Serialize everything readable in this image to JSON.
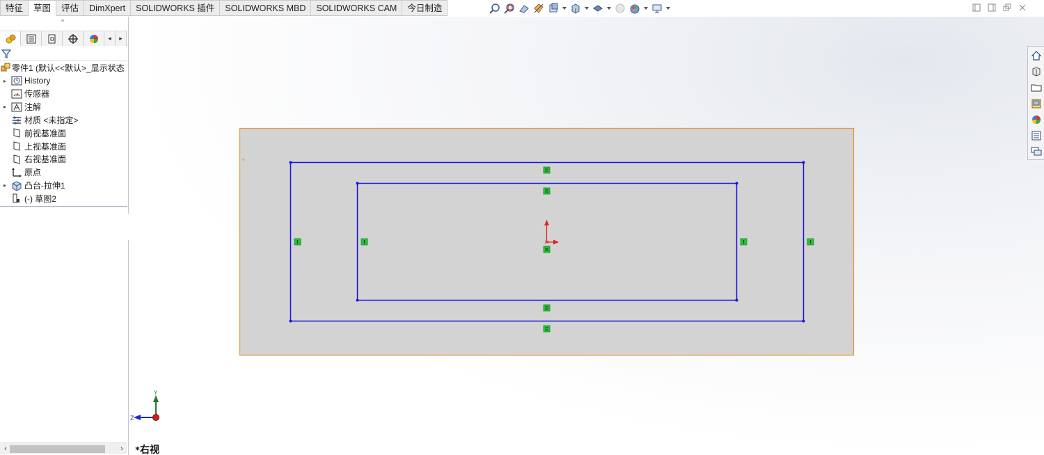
{
  "command_tabs": [
    {
      "label": "特征",
      "active": false
    },
    {
      "label": "草图",
      "active": true
    },
    {
      "label": "评估",
      "active": false
    },
    {
      "label": "DimXpert",
      "active": false
    },
    {
      "label": "SOLIDWORKS 插件",
      "active": false
    },
    {
      "label": "SOLIDWORKS MBD",
      "active": false
    },
    {
      "label": "SOLIDWORKS CAM",
      "active": false
    },
    {
      "label": "今日制造",
      "active": false
    }
  ],
  "heads_up_toolbar": [
    "zoom-to-fit-icon",
    "zoom-to-area-icon",
    "previous-view-icon",
    "section-view-icon",
    "dynamic-annotation-icon",
    "view-orientation-icon",
    "display-style-icon",
    "hide-show-items-icon",
    "edit-appearance-icon",
    "apply-scene-icon",
    "view-settings-icon"
  ],
  "window_controls": [
    "tile-horizontal-icon",
    "tile-vertical-icon",
    "restore-icon",
    "close-icon"
  ],
  "feature_manager": {
    "splitter_grip": "≡",
    "tabs": [
      "feature-manager-icon",
      "property-manager-icon",
      "configuration-manager-icon",
      "dimxpert-manager-icon",
      "display-manager-icon"
    ],
    "tree": [
      {
        "label": "零件1  (默认<<默认>_显示状态",
        "icon": "part-icon",
        "expandable": false,
        "root": true
      },
      {
        "label": "History",
        "icon": "history-icon",
        "expandable": true
      },
      {
        "label": "传感器",
        "icon": "sensor-icon",
        "expandable": false
      },
      {
        "label": "注解",
        "icon": "annotation-icon",
        "expandable": true
      },
      {
        "label": "材质 <未指定>",
        "icon": "material-icon",
        "expandable": false
      },
      {
        "label": "前视基准面",
        "icon": "plane-icon",
        "expandable": false
      },
      {
        "label": "上视基准面",
        "icon": "plane-icon",
        "expandable": false
      },
      {
        "label": "右视基准面",
        "icon": "plane-icon",
        "expandable": false
      },
      {
        "label": "原点",
        "icon": "origin-icon",
        "expandable": false
      },
      {
        "label": "凸台-拉伸1",
        "icon": "extrude-icon",
        "expandable": true
      },
      {
        "label": "(-) 草图2",
        "icon": "sketch-icon",
        "expandable": false
      }
    ]
  },
  "graphics": {
    "view_label": "*右视",
    "triad_axes": {
      "y": "Y",
      "z": "Z"
    },
    "colors": {
      "part_face": "#d3d3d3",
      "part_edge": "#e39a45",
      "sketch_line": "#1515e0",
      "relation_badge": "#2bc43a",
      "origin_red": "#e02020"
    }
  },
  "task_pane": [
    "home-icon",
    "design-library-icon",
    "file-explorer-icon",
    "view-palette-icon",
    "appearances-icon",
    "custom-properties-icon",
    "forum-icon"
  ]
}
